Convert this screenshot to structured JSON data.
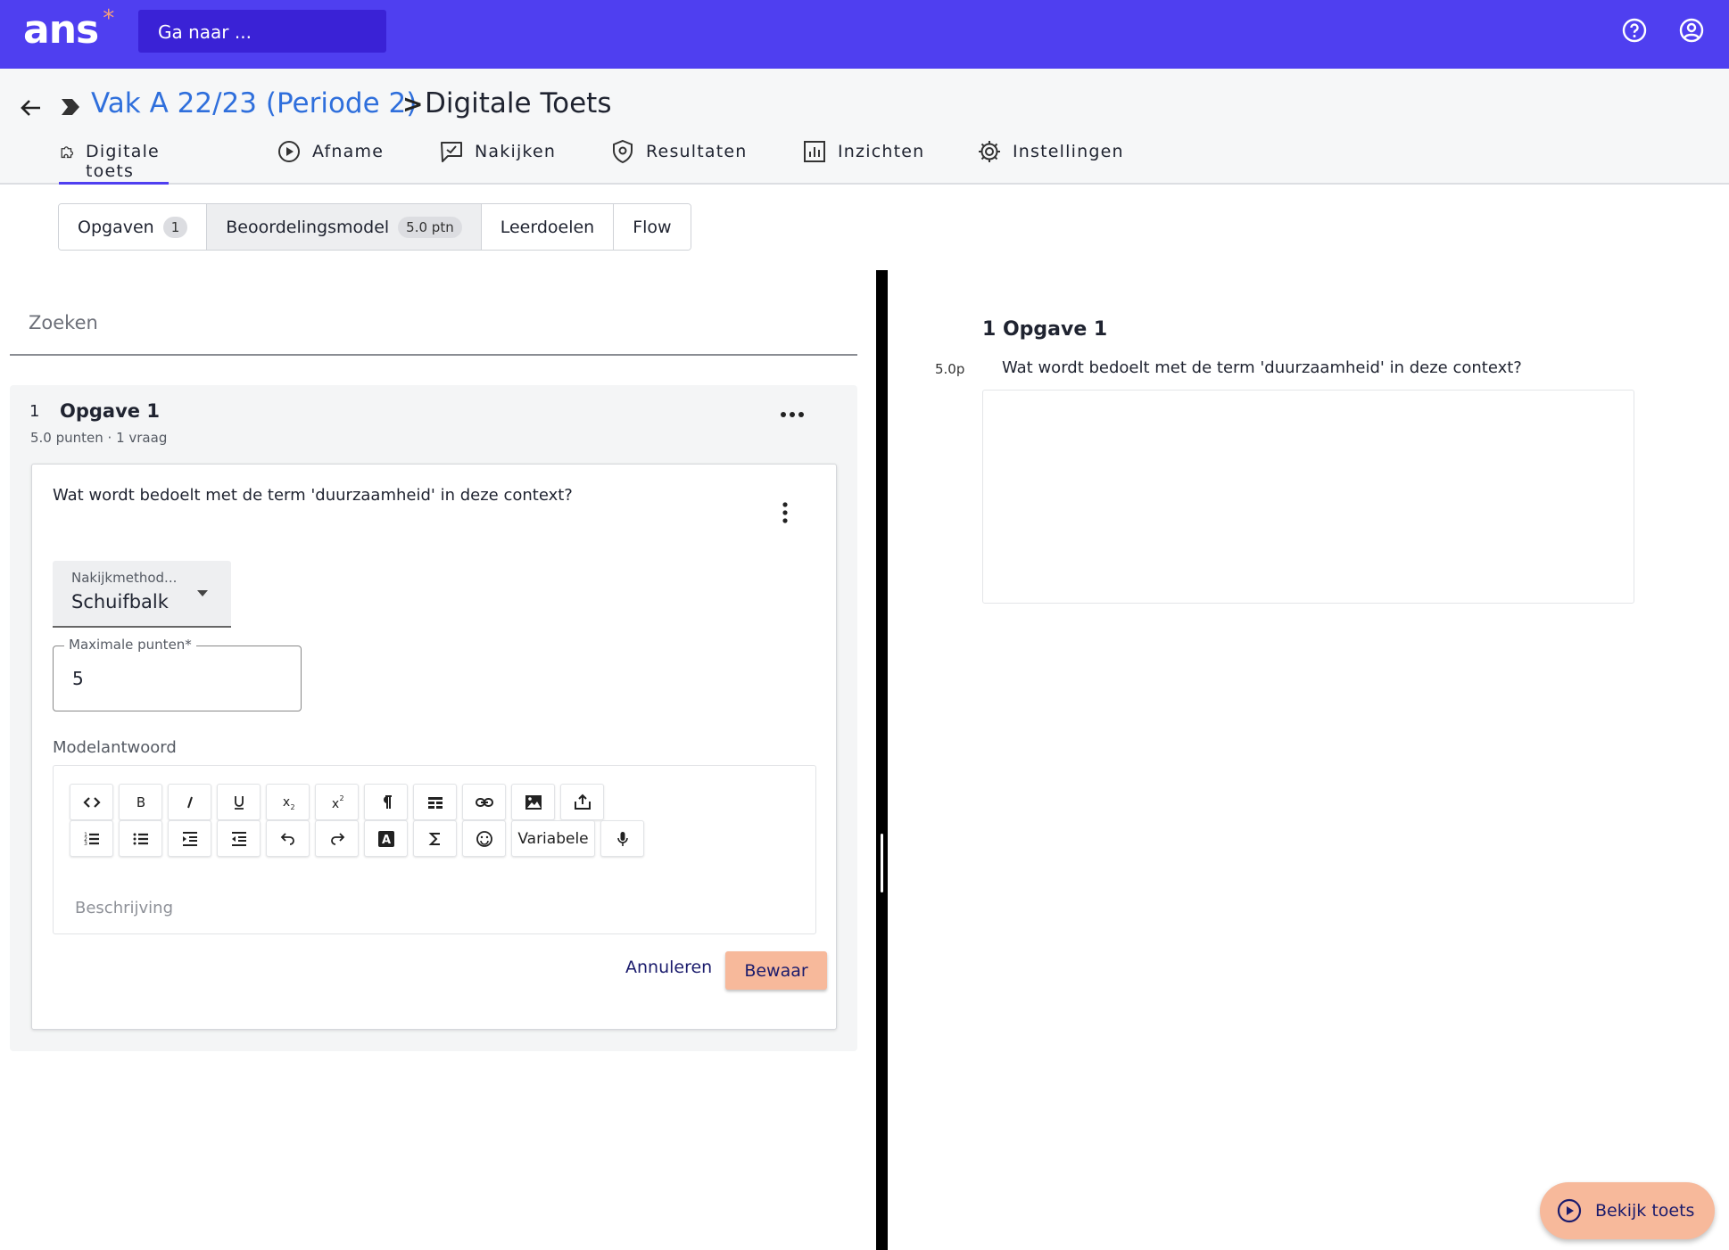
{
  "app": {
    "logo": "ans",
    "goto_placeholder": "Ga naar ..."
  },
  "breadcrumb": {
    "course": "Vak A 22/23 (Periode 2)",
    "separator": ">",
    "page": "Digitale Toets"
  },
  "nav_tabs": [
    {
      "label": "Digitale toets",
      "icon": "puzzle-icon",
      "active": true
    },
    {
      "label": "Afname",
      "icon": "play-circle-icon",
      "active": false
    },
    {
      "label": "Nakijken",
      "icon": "chat-check-icon",
      "active": false
    },
    {
      "label": "Resultaten",
      "icon": "shield-icon",
      "active": false
    },
    {
      "label": "Inzichten",
      "icon": "chart-icon",
      "active": false
    },
    {
      "label": "Instellingen",
      "icon": "gear-icon",
      "active": false
    }
  ],
  "segments": [
    {
      "label": "Opgaven",
      "badge": "1",
      "active": false
    },
    {
      "label": "Beoordelingsmodel",
      "badge": "5.0 ptn",
      "active": true
    },
    {
      "label": "Leerdoelen",
      "badge": "",
      "active": false
    },
    {
      "label": "Flow",
      "badge": "",
      "active": false
    }
  ],
  "search": {
    "placeholder": "Zoeken"
  },
  "exercise": {
    "number": "1",
    "title": "Opgave 1",
    "meta": "5.0 punten · 1 vraag",
    "question": {
      "text": "Wat wordt bedoelt met de term 'duurzaamheid' in deze context?",
      "method_label": "Nakijkmethod...",
      "method_value": "Schuifbalk",
      "max_points_label": "Maximale punten*",
      "max_points_value": "5",
      "model_answer_label": "Modelantwoord",
      "editor_placeholder": "Beschrijving",
      "variable_button": "Variabele",
      "cancel": "Annuleren",
      "save": "Bewaar"
    }
  },
  "preview": {
    "title": "1 Opgave 1",
    "points": "5.0p",
    "question": "Wat wordt bedoelt met de term 'duurzaamheid' in deze context?"
  },
  "fab": {
    "label": "Bekijk toets"
  },
  "colors": {
    "brand": "#4f3ff0",
    "accent": "#f7b99b",
    "link": "#2f6fdc"
  }
}
